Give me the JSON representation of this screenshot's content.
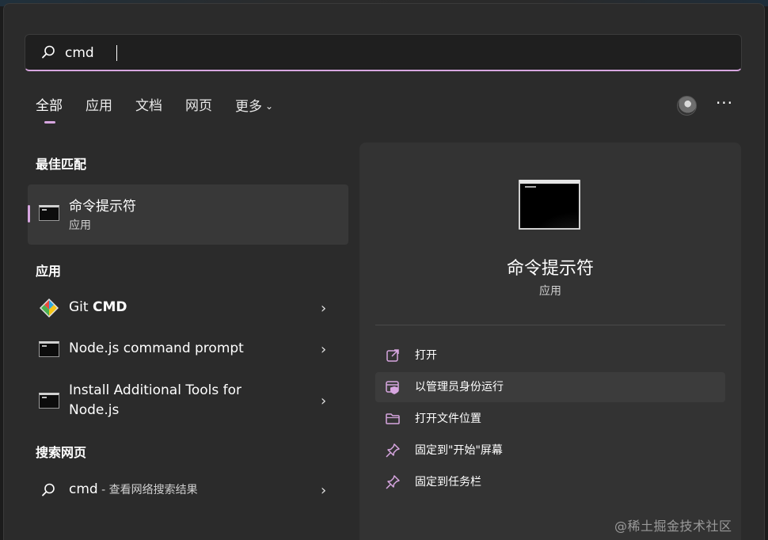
{
  "search": {
    "value": "cmd"
  },
  "tabs": [
    {
      "label": "全部",
      "active": true
    },
    {
      "label": "应用",
      "active": false
    },
    {
      "label": "文档",
      "active": false
    },
    {
      "label": "网页",
      "active": false
    },
    {
      "label": "更多",
      "active": false
    }
  ],
  "header_icons": {
    "avatar": "user-avatar",
    "more": "···"
  },
  "best_match": {
    "section_title": "最佳匹配",
    "name": "命令提示符",
    "sub": "应用"
  },
  "apps": {
    "section_title": "应用",
    "items": [
      {
        "label_prefix": "Git ",
        "label_bold": "CMD",
        "icon": "git-icon"
      },
      {
        "label": "Node.js command prompt",
        "icon": "cmd-icon"
      },
      {
        "label_line1": "Install Additional Tools for",
        "label_line2": "Node.js",
        "icon": "cmd-icon"
      }
    ]
  },
  "web": {
    "section_title": "搜索网页",
    "query": "cmd",
    "hint": " - 查看网络搜索结果"
  },
  "detail": {
    "title": "命令提示符",
    "sub": "应用",
    "actions": [
      {
        "label": "打开",
        "icon": "open-external-icon"
      },
      {
        "label": "以管理员身份运行",
        "icon": "shield-admin-icon"
      },
      {
        "label": "打开文件位置",
        "icon": "folder-icon"
      },
      {
        "label": "固定到\"开始\"屏幕",
        "icon": "pin-icon"
      },
      {
        "label": "固定到任务栏",
        "icon": "pin-icon"
      }
    ]
  },
  "watermark": "@稀土掘金技术社区",
  "colors": {
    "accent": "#d7a6e0",
    "panel": "#2b2b2b",
    "right_pane": "#333333",
    "selected_item": "#383838"
  }
}
